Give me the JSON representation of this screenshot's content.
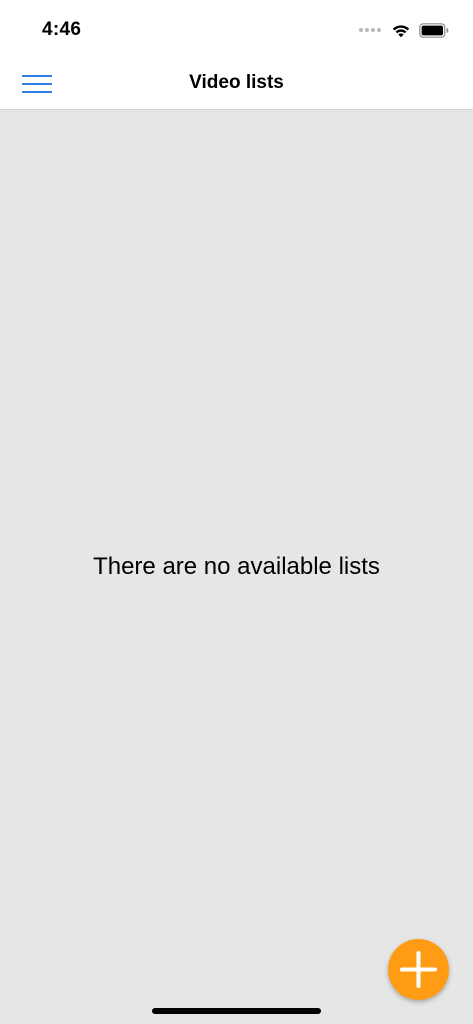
{
  "status_bar": {
    "time": "4:46"
  },
  "nav_bar": {
    "title": "Video lists"
  },
  "content": {
    "empty_message": "There are no available lists"
  },
  "colors": {
    "accent": "#2f80e4",
    "fab": "#ff9c13",
    "background": "#e6e6e6",
    "bar": "#ffffff"
  },
  "icons": {
    "menu": "hamburger-menu-icon",
    "add": "plus-icon",
    "wifi": "wifi-icon",
    "battery": "battery-icon"
  }
}
